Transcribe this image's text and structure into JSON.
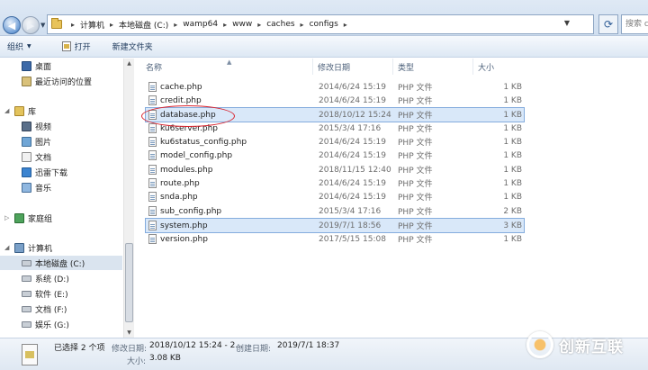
{
  "address": {
    "crumbs": [
      "计算机",
      "本地磁盘 (C:)",
      "wamp64",
      "www",
      "caches",
      "configs"
    ],
    "search_placeholder": "搜索 configs"
  },
  "toolbar": {
    "organize": "组织",
    "open": "打开",
    "new_folder": "新建文件夹"
  },
  "sidebar": {
    "items": [
      {
        "label": "桌面",
        "icon": "desktop-icon"
      },
      {
        "label": "最近访问的位置",
        "icon": "recent-places-icon"
      },
      {
        "label": "库",
        "icon": "library-icon"
      },
      {
        "label": "视频",
        "icon": "video-icon"
      },
      {
        "label": "图片",
        "icon": "pictures-icon"
      },
      {
        "label": "文档",
        "icon": "documents-icon"
      },
      {
        "label": "迅雷下载",
        "icon": "thunder-download-icon"
      },
      {
        "label": "音乐",
        "icon": "music-icon"
      },
      {
        "label": "家庭组",
        "icon": "homegroup-icon"
      },
      {
        "label": "计算机",
        "icon": "computer-icon"
      },
      {
        "label": "本地磁盘 (C:)",
        "icon": "drive-icon"
      },
      {
        "label": "系统 (D:)",
        "icon": "drive-icon"
      },
      {
        "label": "软件 (E:)",
        "icon": "drive-icon"
      },
      {
        "label": "文档 (F:)",
        "icon": "drive-icon"
      },
      {
        "label": "娱乐 (G:)",
        "icon": "drive-icon"
      }
    ]
  },
  "columns": {
    "name": "名称",
    "date": "修改日期",
    "type": "类型",
    "size": "大小"
  },
  "files": [
    {
      "name": "cache.php",
      "date": "2014/6/24 15:19",
      "type": "PHP 文件",
      "size": "1 KB",
      "selected": false
    },
    {
      "name": "credit.php",
      "date": "2014/6/24 15:19",
      "type": "PHP 文件",
      "size": "1 KB",
      "selected": false
    },
    {
      "name": "database.php",
      "date": "2018/10/12 15:24",
      "type": "PHP 文件",
      "size": "1 KB",
      "selected": true
    },
    {
      "name": "ku6server.php",
      "date": "2015/3/4 17:16",
      "type": "PHP 文件",
      "size": "1 KB",
      "selected": false
    },
    {
      "name": "ku6status_config.php",
      "date": "2014/6/24 15:19",
      "type": "PHP 文件",
      "size": "1 KB",
      "selected": false
    },
    {
      "name": "model_config.php",
      "date": "2014/6/24 15:19",
      "type": "PHP 文件",
      "size": "1 KB",
      "selected": false
    },
    {
      "name": "modules.php",
      "date": "2018/11/15 12:40",
      "type": "PHP 文件",
      "size": "1 KB",
      "selected": false
    },
    {
      "name": "route.php",
      "date": "2014/6/24 15:19",
      "type": "PHP 文件",
      "size": "1 KB",
      "selected": false
    },
    {
      "name": "snda.php",
      "date": "2014/6/24 15:19",
      "type": "PHP 文件",
      "size": "1 KB",
      "selected": false
    },
    {
      "name": "sub_config.php",
      "date": "2015/3/4 17:16",
      "type": "PHP 文件",
      "size": "2 KB",
      "selected": false
    },
    {
      "name": "system.php",
      "date": "2019/7/1 18:56",
      "type": "PHP 文件",
      "size": "3 KB",
      "selected": true
    },
    {
      "name": "version.php",
      "date": "2017/5/15 15:08",
      "type": "PHP 文件",
      "size": "1 KB",
      "selected": false
    }
  ],
  "status": {
    "selected_count": "已选择 2 个项",
    "modified_label": "修改日期:",
    "modified_value": "2018/10/12 15:24 - 2...",
    "created_label": "创建日期:",
    "created_value": "2019/7/1 18:37",
    "size_label": "大小:",
    "size_value": "3.08 KB"
  },
  "watermark": {
    "text": "创新互联"
  }
}
